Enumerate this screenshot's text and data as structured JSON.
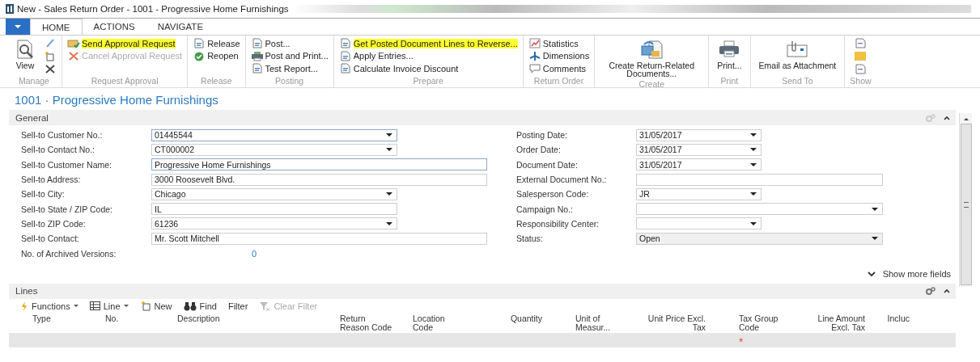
{
  "window": {
    "title": "New - Sales Return Order - 1001 - Progressive Home Furnishings"
  },
  "ribbon_tabs": [
    {
      "label": "HOME",
      "selected": true
    },
    {
      "label": "ACTIONS",
      "selected": false
    },
    {
      "label": "NAVIGATE",
      "selected": false
    }
  ],
  "ribbon_groups": [
    {
      "label": "Manage",
      "items": [
        {
          "kind": "large",
          "label": "View"
        },
        {
          "kind": "icon"
        },
        {
          "kind": "icon"
        },
        {
          "kind": "icon"
        }
      ]
    },
    {
      "label": "Request Approval",
      "items": [
        {
          "kind": "small",
          "label": "Send Approval Request",
          "highlighted": true,
          "disabled": false
        },
        {
          "kind": "small",
          "label": "Cancel Approval Request",
          "highlighted": false,
          "disabled": true
        }
      ]
    },
    {
      "label": "Release",
      "items": [
        {
          "kind": "small",
          "label": "Release",
          "highlighted": false,
          "disabled": false
        },
        {
          "kind": "small",
          "label": "Reopen",
          "highlighted": false,
          "disabled": false
        }
      ]
    },
    {
      "label": "Posting",
      "items": [
        {
          "kind": "small",
          "label": "Post...",
          "highlighted": false,
          "disabled": false
        },
        {
          "kind": "small",
          "label": "Post and Print...",
          "highlighted": false,
          "disabled": false
        },
        {
          "kind": "small",
          "label": "Test Report...",
          "highlighted": false,
          "disabled": false
        }
      ]
    },
    {
      "label": "Prepare",
      "items": [
        {
          "kind": "small",
          "label": "Get Posted Document Lines to Reverse...",
          "highlighted": true,
          "disabled": false
        },
        {
          "kind": "small",
          "label": "Apply Entries...",
          "highlighted": false,
          "disabled": false
        },
        {
          "kind": "small",
          "label": "Calculate Invoice Discount",
          "highlighted": false,
          "disabled": false
        }
      ]
    },
    {
      "label": "Return Order",
      "items": [
        {
          "kind": "small",
          "label": "Statistics",
          "highlighted": false,
          "disabled": false
        },
        {
          "kind": "small",
          "label": "Dimensions",
          "highlighted": false,
          "disabled": false
        },
        {
          "kind": "small",
          "label": "Comments",
          "highlighted": false,
          "disabled": false
        }
      ]
    },
    {
      "label": "Create",
      "items": [
        {
          "kind": "large",
          "label": "Create Return-Related Documents..."
        }
      ]
    },
    {
      "label": "Print",
      "items": [
        {
          "kind": "large",
          "label": "Print..."
        }
      ]
    },
    {
      "label": "Send To",
      "items": [
        {
          "kind": "large",
          "label": "Email as Attachment"
        }
      ]
    },
    {
      "label": "Show",
      "items": [
        {
          "kind": "icon"
        },
        {
          "kind": "icon"
        },
        {
          "kind": "icon"
        }
      ]
    }
  ],
  "page_title": "1001 · Progressive Home Furnishings",
  "general": {
    "title": "General",
    "expanded": true,
    "left_fields": [
      {
        "label": "Sell-to Customer No.:",
        "value": "01445544",
        "kind": "narrow",
        "dropdown": true,
        "focused": true
      },
      {
        "label": "Sell-to Contact No.:",
        "value": "CT000002",
        "kind": "narrow",
        "dropdown": true,
        "focused": false
      },
      {
        "label": "Sell-to Customer Name:",
        "value": "Progressive Home Furnishings",
        "kind": "wide",
        "dropdown": false,
        "focused": true
      },
      {
        "label": "Sell-to Address:",
        "value": "3000 Roosevelt Blvd.",
        "kind": "wide",
        "dropdown": false,
        "focused": false
      },
      {
        "label": "Sell-to City:",
        "value": "Chicago",
        "kind": "narrow",
        "dropdown": true,
        "focused": false
      },
      {
        "label": "Sell-to State / ZIP Code:",
        "value": "IL",
        "kind": "narrow",
        "dropdown": false,
        "focused": false
      },
      {
        "label": "Sell-to ZIP Code:",
        "value": "61236",
        "kind": "narrow",
        "dropdown": true,
        "focused": false
      },
      {
        "label": "Sell-to Contact:",
        "value": "Mr. Scott Mitchell",
        "kind": "wide",
        "dropdown": false,
        "focused": false
      },
      {
        "label": "No. of Archived Versions:",
        "value": "0",
        "kind": "link"
      }
    ],
    "right_fields": [
      {
        "label": "Posting Date:",
        "value": "31/05/2017",
        "kind": "narrow",
        "dropdown": true,
        "disabled": false
      },
      {
        "label": "Order Date:",
        "value": "31/05/2017",
        "kind": "narrow",
        "dropdown": true,
        "disabled": false
      },
      {
        "label": "Document Date:",
        "value": "31/05/2017",
        "kind": "narrow",
        "dropdown": true,
        "disabled": false
      },
      {
        "label": "External Document No.:",
        "kind": "wide",
        "dropdown": false,
        "disabled": false
      },
      {
        "label": "Salesperson Code:",
        "value": "JR",
        "kind": "narrow",
        "dropdown": true,
        "disabled": false
      },
      {
        "label": "Campaign No.:",
        "kind": "wide",
        "dropdown": true,
        "disabled": false
      },
      {
        "label": "Responsibility Center:",
        "kind": "narrow",
        "dropdown": true,
        "disabled": false
      },
      {
        "label": "Status:",
        "value": "Open",
        "kind": "wide",
        "dropdown": true,
        "disabled": true
      }
    ],
    "show_more": "Show more fields"
  },
  "lines": {
    "title": "Lines",
    "expanded": true,
    "toolbar": [
      {
        "label": "Functions",
        "menu": true,
        "disabled": false
      },
      {
        "label": "Line",
        "menu": true,
        "disabled": false
      },
      {
        "label": "New",
        "menu": false,
        "disabled": false
      },
      {
        "label": "Find",
        "menu": false,
        "disabled": false
      },
      {
        "label": "Filter",
        "menu": false,
        "disabled": false
      },
      {
        "label": "Clear Filter",
        "menu": false,
        "disabled": true
      }
    ],
    "columns": [
      {
        "lines": [
          "Type"
        ],
        "required": false
      },
      {
        "lines": [
          "No."
        ],
        "required": false
      },
      {
        "lines": [
          "Description"
        ],
        "required": false
      },
      {
        "lines": [
          "Return",
          "Reason Code"
        ],
        "required": false
      },
      {
        "lines": [
          "Location",
          "Code"
        ],
        "required": false
      },
      {
        "lines": [
          "Quantity"
        ],
        "required": false
      },
      {
        "lines": [
          "Unit of",
          "Measur..."
        ],
        "required": false
      },
      {
        "lines": [
          "Unit Price Excl.",
          "Tax"
        ],
        "required": false
      },
      {
        "lines": [
          "Tax Group",
          "Code"
        ],
        "required": true
      },
      {
        "lines": [
          "Line Amount",
          "Excl. Tax"
        ],
        "required": false
      },
      {
        "lines": [
          "Incluc"
        ],
        "required": false
      }
    ],
    "required_mark": "*"
  }
}
